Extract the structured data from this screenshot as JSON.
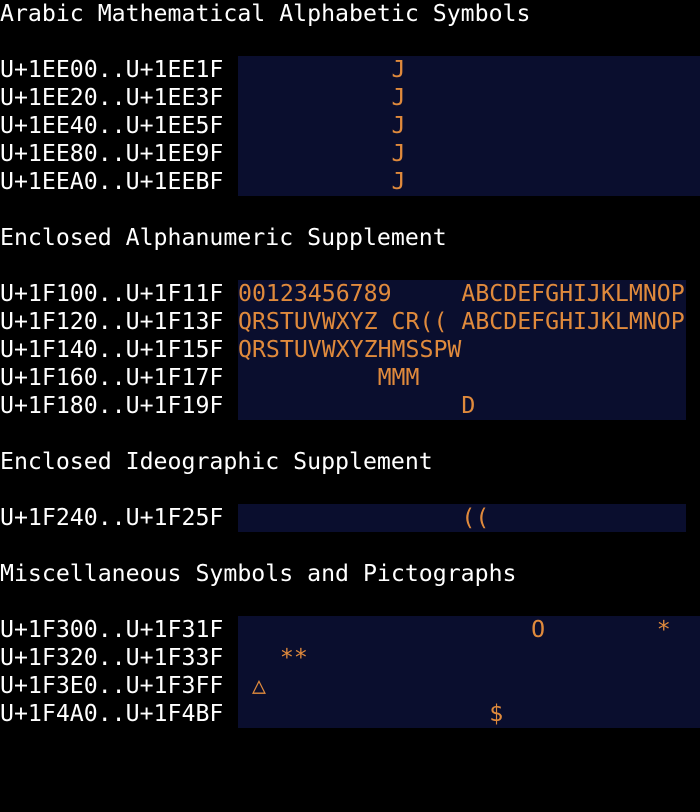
{
  "sections": [
    {
      "title": "Arabic Mathematical Alphabetic Symbols",
      "rows": [
        {
          "range": "U+1EE00..U+1EE1F",
          "glyphs": "           J"
        },
        {
          "range": "U+1EE20..U+1EE3F",
          "glyphs": "           J"
        },
        {
          "range": "U+1EE40..U+1EE5F",
          "glyphs": "           J"
        },
        {
          "range": "U+1EE80..U+1EE9F",
          "glyphs": "           J"
        },
        {
          "range": "U+1EEA0..U+1EEBF",
          "glyphs": "           J"
        }
      ]
    },
    {
      "title": "Enclosed Alphanumeric Supplement",
      "rows": [
        {
          "range": "U+1F100..U+1F11F",
          "glyphs": "00123456789     ABCDEFGHIJKLMNOP"
        },
        {
          "range": "U+1F120..U+1F13F",
          "glyphs": "QRSTUVWXYZ CR(( ABCDEFGHIJKLMNOP"
        },
        {
          "range": "U+1F140..U+1F15F",
          "glyphs": "QRSTUVWXYZHMSSPW"
        },
        {
          "range": "U+1F160..U+1F17F",
          "glyphs": "          MMM"
        },
        {
          "range": "U+1F180..U+1F19F",
          "glyphs": "                D"
        }
      ]
    },
    {
      "title": "Enclosed Ideographic Supplement",
      "rows": [
        {
          "range": "U+1F240..U+1F25F",
          "glyphs": "                (("
        }
      ]
    },
    {
      "title": "Miscellaneous Symbols and Pictographs",
      "rows": [
        {
          "range": "U+1F300..U+1F31F",
          "glyphs": "                     O        *"
        },
        {
          "range": "U+1F320..U+1F33F",
          "glyphs": "   **"
        },
        {
          "range": "U+1F3E0..U+1F3FF",
          "glyphs": " △"
        },
        {
          "range": "U+1F4A0..U+1F4BF",
          "glyphs": "                  $"
        }
      ]
    }
  ]
}
